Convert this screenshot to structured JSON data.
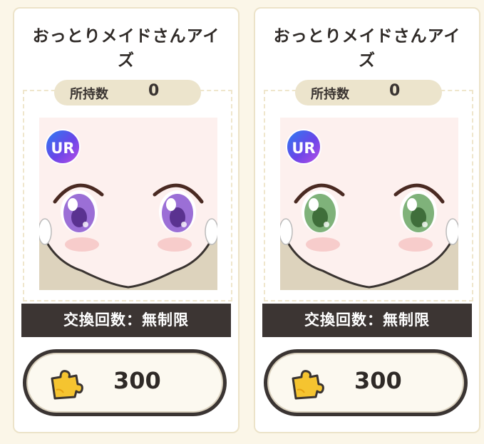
{
  "cards": [
    {
      "title": "おっとりメイドさんアイズ",
      "owned_label": "所持数",
      "owned_count": "0",
      "rarity": "UR",
      "eye_color": "#9b6fd6",
      "exchange_limit": "交換回数：無制限",
      "price": "300",
      "currency_icon": "puzzle-piece-icon"
    },
    {
      "title": "おっとりメイドさんアイズ",
      "owned_label": "所持数",
      "owned_count": "0",
      "rarity": "UR",
      "eye_color": "#7fb27a",
      "exchange_limit": "交換回数：無制限",
      "price": "300",
      "currency_icon": "puzzle-piece-icon"
    }
  ]
}
